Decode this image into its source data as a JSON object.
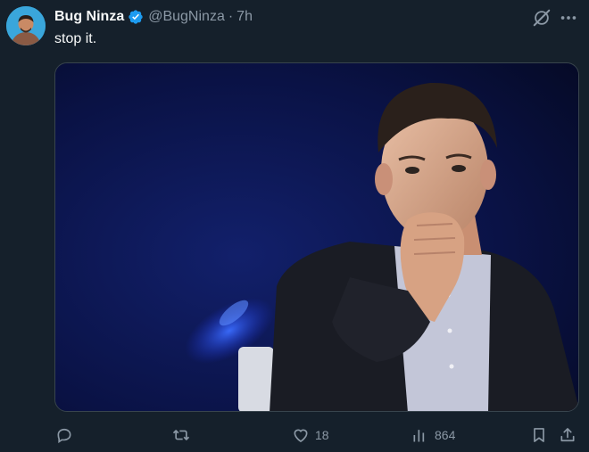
{
  "tweet": {
    "display_name": "Bug Ninza",
    "handle": "@BugNinza",
    "separator": "·",
    "time": "7h",
    "text": "stop it.",
    "verified": true
  },
  "icons": {
    "verified": "verified-badge-icon",
    "grok": "grok-icon",
    "more": "more-icon",
    "reply": "reply-icon",
    "retweet": "retweet-icon",
    "like": "heart-icon",
    "views": "views-icon",
    "bookmark": "bookmark-icon",
    "share": "share-icon"
  },
  "actions": {
    "reply_count": "",
    "retweet_count": "",
    "like_count": "18",
    "views_count": "864"
  },
  "colors": {
    "background": "#15202b",
    "muted": "#8b98a5",
    "text": "#f7f9f9",
    "verified": "#1d9bf0"
  }
}
